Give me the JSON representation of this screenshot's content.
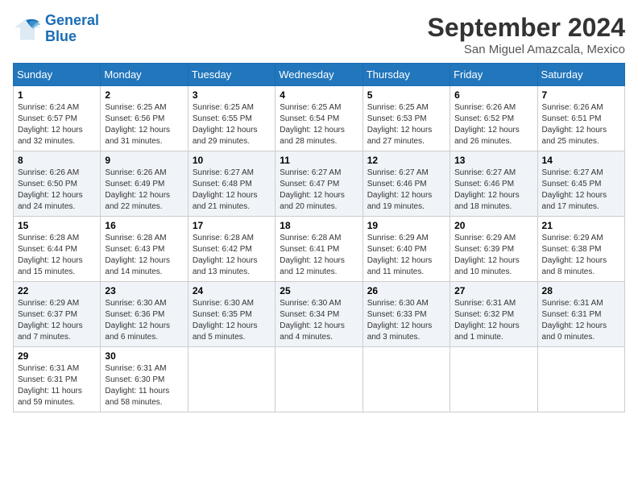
{
  "logo": {
    "line1": "General",
    "line2": "Blue"
  },
  "title": "September 2024",
  "subtitle": "San Miguel Amazcala, Mexico",
  "days_header": [
    "Sunday",
    "Monday",
    "Tuesday",
    "Wednesday",
    "Thursday",
    "Friday",
    "Saturday"
  ],
  "weeks": [
    [
      {
        "day": "1",
        "info": "Sunrise: 6:24 AM\nSunset: 6:57 PM\nDaylight: 12 hours and 32 minutes."
      },
      {
        "day": "2",
        "info": "Sunrise: 6:25 AM\nSunset: 6:56 PM\nDaylight: 12 hours and 31 minutes."
      },
      {
        "day": "3",
        "info": "Sunrise: 6:25 AM\nSunset: 6:55 PM\nDaylight: 12 hours and 29 minutes."
      },
      {
        "day": "4",
        "info": "Sunrise: 6:25 AM\nSunset: 6:54 PM\nDaylight: 12 hours and 28 minutes."
      },
      {
        "day": "5",
        "info": "Sunrise: 6:25 AM\nSunset: 6:53 PM\nDaylight: 12 hours and 27 minutes."
      },
      {
        "day": "6",
        "info": "Sunrise: 6:26 AM\nSunset: 6:52 PM\nDaylight: 12 hours and 26 minutes."
      },
      {
        "day": "7",
        "info": "Sunrise: 6:26 AM\nSunset: 6:51 PM\nDaylight: 12 hours and 25 minutes."
      }
    ],
    [
      {
        "day": "8",
        "info": "Sunrise: 6:26 AM\nSunset: 6:50 PM\nDaylight: 12 hours and 24 minutes."
      },
      {
        "day": "9",
        "info": "Sunrise: 6:26 AM\nSunset: 6:49 PM\nDaylight: 12 hours and 22 minutes."
      },
      {
        "day": "10",
        "info": "Sunrise: 6:27 AM\nSunset: 6:48 PM\nDaylight: 12 hours and 21 minutes."
      },
      {
        "day": "11",
        "info": "Sunrise: 6:27 AM\nSunset: 6:47 PM\nDaylight: 12 hours and 20 minutes."
      },
      {
        "day": "12",
        "info": "Sunrise: 6:27 AM\nSunset: 6:46 PM\nDaylight: 12 hours and 19 minutes."
      },
      {
        "day": "13",
        "info": "Sunrise: 6:27 AM\nSunset: 6:46 PM\nDaylight: 12 hours and 18 minutes."
      },
      {
        "day": "14",
        "info": "Sunrise: 6:27 AM\nSunset: 6:45 PM\nDaylight: 12 hours and 17 minutes."
      }
    ],
    [
      {
        "day": "15",
        "info": "Sunrise: 6:28 AM\nSunset: 6:44 PM\nDaylight: 12 hours and 15 minutes."
      },
      {
        "day": "16",
        "info": "Sunrise: 6:28 AM\nSunset: 6:43 PM\nDaylight: 12 hours and 14 minutes."
      },
      {
        "day": "17",
        "info": "Sunrise: 6:28 AM\nSunset: 6:42 PM\nDaylight: 12 hours and 13 minutes."
      },
      {
        "day": "18",
        "info": "Sunrise: 6:28 AM\nSunset: 6:41 PM\nDaylight: 12 hours and 12 minutes."
      },
      {
        "day": "19",
        "info": "Sunrise: 6:29 AM\nSunset: 6:40 PM\nDaylight: 12 hours and 11 minutes."
      },
      {
        "day": "20",
        "info": "Sunrise: 6:29 AM\nSunset: 6:39 PM\nDaylight: 12 hours and 10 minutes."
      },
      {
        "day": "21",
        "info": "Sunrise: 6:29 AM\nSunset: 6:38 PM\nDaylight: 12 hours and 8 minutes."
      }
    ],
    [
      {
        "day": "22",
        "info": "Sunrise: 6:29 AM\nSunset: 6:37 PM\nDaylight: 12 hours and 7 minutes."
      },
      {
        "day": "23",
        "info": "Sunrise: 6:30 AM\nSunset: 6:36 PM\nDaylight: 12 hours and 6 minutes."
      },
      {
        "day": "24",
        "info": "Sunrise: 6:30 AM\nSunset: 6:35 PM\nDaylight: 12 hours and 5 minutes."
      },
      {
        "day": "25",
        "info": "Sunrise: 6:30 AM\nSunset: 6:34 PM\nDaylight: 12 hours and 4 minutes."
      },
      {
        "day": "26",
        "info": "Sunrise: 6:30 AM\nSunset: 6:33 PM\nDaylight: 12 hours and 3 minutes."
      },
      {
        "day": "27",
        "info": "Sunrise: 6:31 AM\nSunset: 6:32 PM\nDaylight: 12 hours and 1 minute."
      },
      {
        "day": "28",
        "info": "Sunrise: 6:31 AM\nSunset: 6:31 PM\nDaylight: 12 hours and 0 minutes."
      }
    ],
    [
      {
        "day": "29",
        "info": "Sunrise: 6:31 AM\nSunset: 6:31 PM\nDaylight: 11 hours and 59 minutes."
      },
      {
        "day": "30",
        "info": "Sunrise: 6:31 AM\nSunset: 6:30 PM\nDaylight: 11 hours and 58 minutes."
      },
      {
        "day": "",
        "info": ""
      },
      {
        "day": "",
        "info": ""
      },
      {
        "day": "",
        "info": ""
      },
      {
        "day": "",
        "info": ""
      },
      {
        "day": "",
        "info": ""
      }
    ]
  ]
}
